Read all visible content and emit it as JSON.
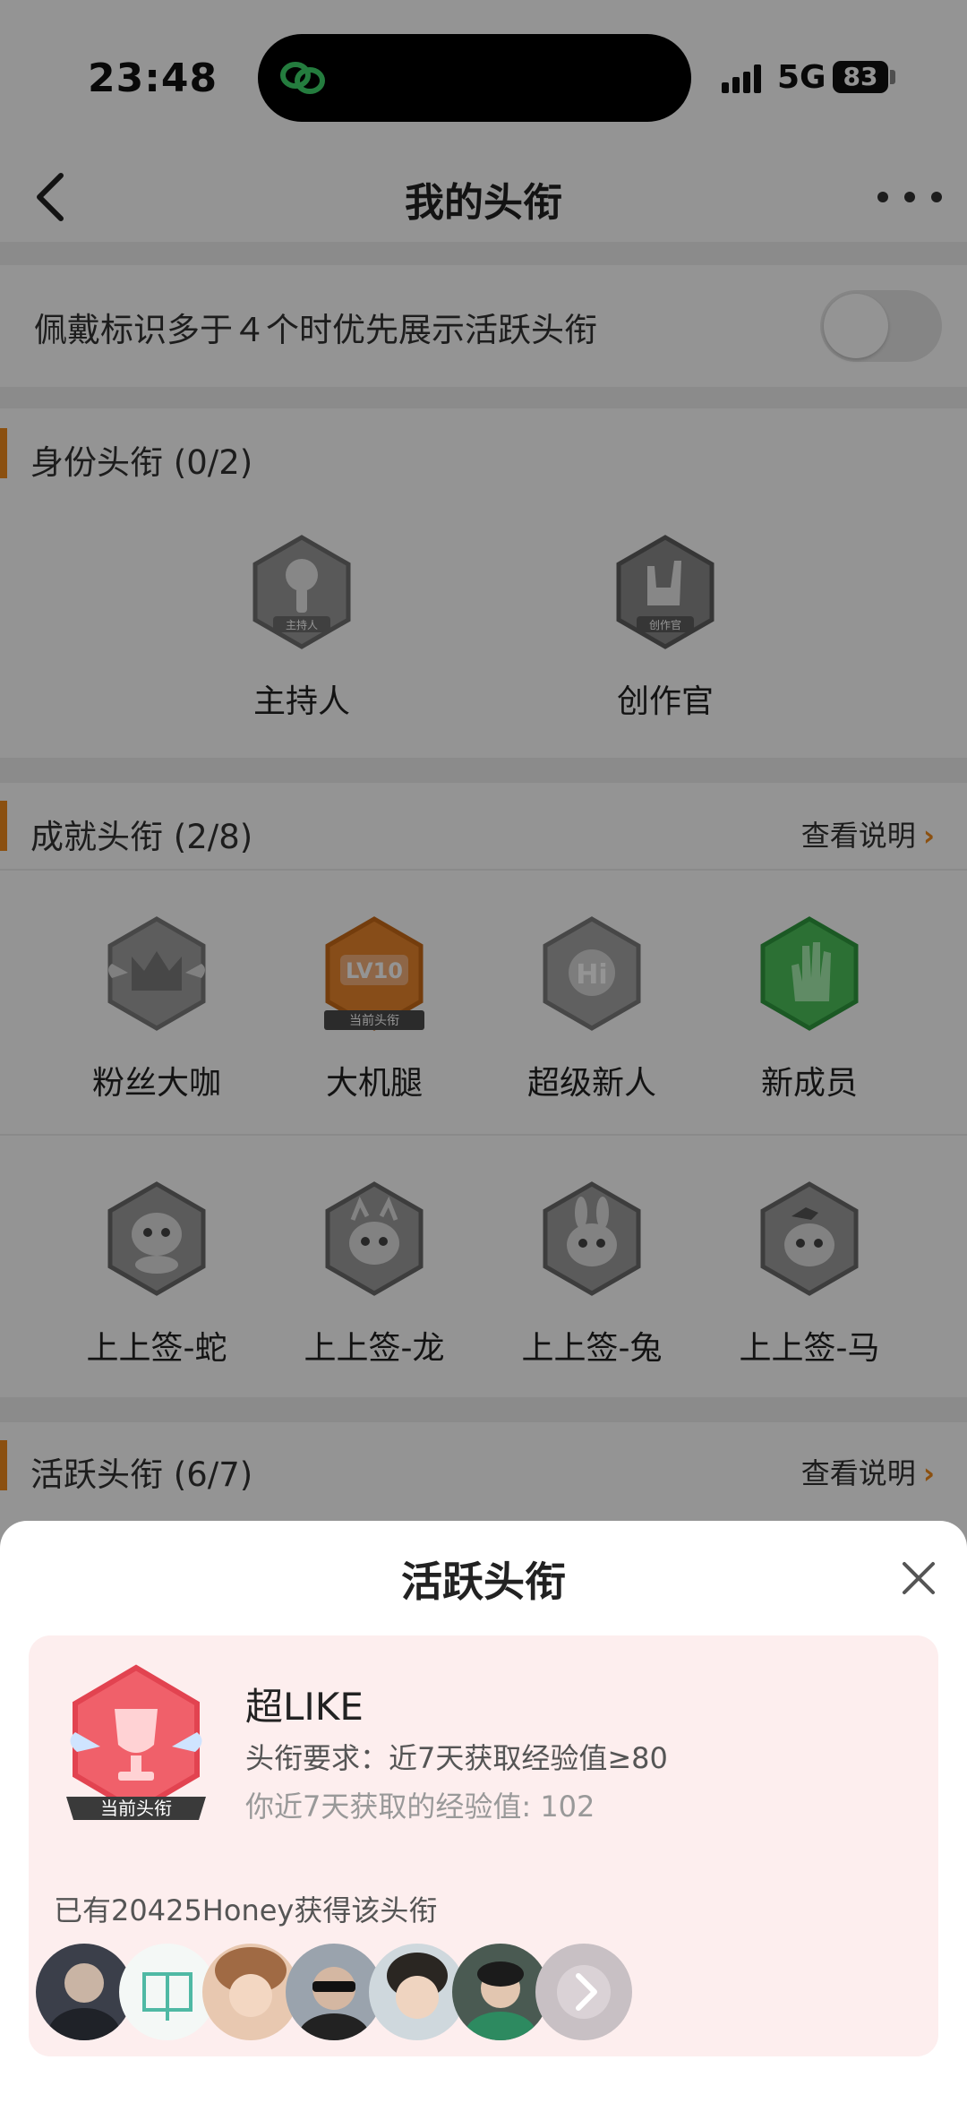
{
  "status_bar": {
    "time": "23:48",
    "network": "5G",
    "battery": "83"
  },
  "nav": {
    "title": "我的头衔"
  },
  "toggle_row": {
    "label": "佩戴标识多于４个时优先展示活跃头衔",
    "enabled": false
  },
  "identity_section": {
    "title": "身份头衔 (0/2)",
    "badges": [
      {
        "label": "主持人",
        "icon_text": "主持人",
        "icon": "microphone-icon"
      },
      {
        "label": "创作官",
        "icon_text": "创作官",
        "icon": "rock-hand-icon"
      }
    ]
  },
  "achievement_section": {
    "title": "成就头衔 (2/8)",
    "link": "查看说明",
    "badges": [
      {
        "label": "粉丝大咖",
        "icon": "crown-icon"
      },
      {
        "label": "大机腿",
        "icon": "lv10-icon",
        "icon_text": "LV10",
        "tag": "当前头衔"
      },
      {
        "label": "超级新人",
        "icon": "hi-icon",
        "icon_text": "Hi"
      },
      {
        "label": "新成员",
        "icon": "hand-icon"
      },
      {
        "label": "上上签-蛇",
        "icon": "snake-icon"
      },
      {
        "label": "上上签-龙",
        "icon": "dragon-icon"
      },
      {
        "label": "上上签-兔",
        "icon": "rabbit-icon"
      },
      {
        "label": "上上签-马",
        "icon": "horse-icon"
      }
    ]
  },
  "active_section": {
    "title": "活跃头衔 (6/7)",
    "link": "查看说明"
  },
  "sheet": {
    "title": "活跃头衔",
    "badge_name": "超LIKE",
    "badge_tag": "当前头衔",
    "requirement": "头衔要求：近7天获取经验值≥80",
    "your_exp": "你近7天获取的经验值: 102",
    "owners": "已有20425Honey获得该头衔"
  },
  "colors": {
    "accent": "#f08a1c",
    "badge_gray": "#8f8f8f",
    "badge_green": "#4cc25a",
    "badge_red": "#f0606a",
    "pink_bg": "#fdeeee"
  }
}
